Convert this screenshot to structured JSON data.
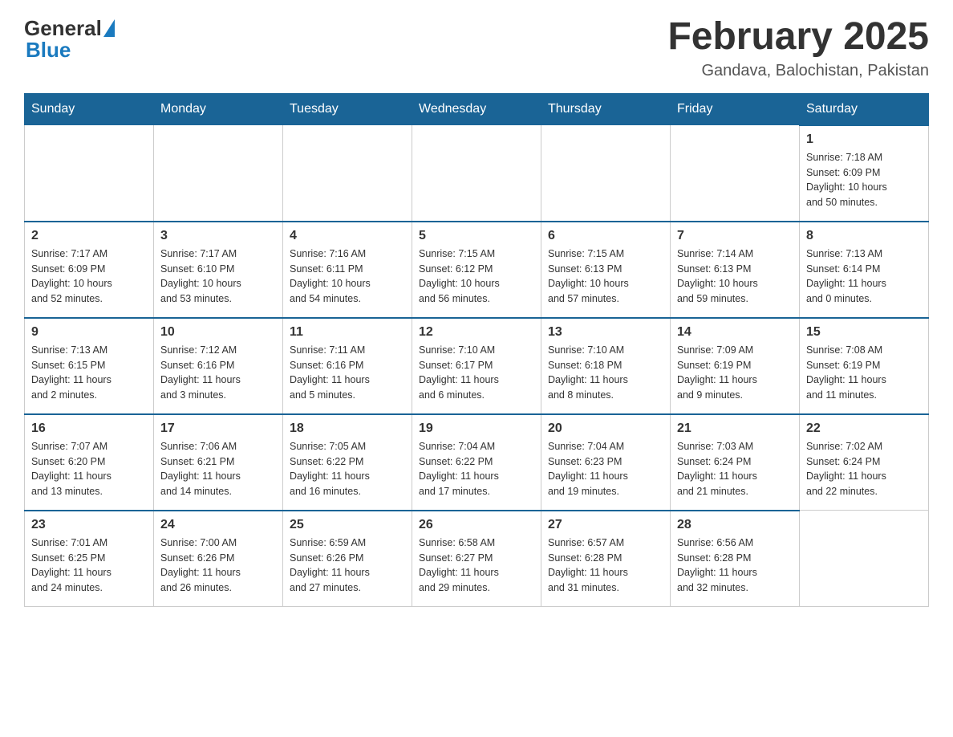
{
  "header": {
    "logo_general": "General",
    "logo_blue": "Blue",
    "title": "February 2025",
    "subtitle": "Gandava, Balochistan, Pakistan"
  },
  "days_of_week": [
    "Sunday",
    "Monday",
    "Tuesday",
    "Wednesday",
    "Thursday",
    "Friday",
    "Saturday"
  ],
  "weeks": [
    [
      {
        "day": "",
        "info": ""
      },
      {
        "day": "",
        "info": ""
      },
      {
        "day": "",
        "info": ""
      },
      {
        "day": "",
        "info": ""
      },
      {
        "day": "",
        "info": ""
      },
      {
        "day": "",
        "info": ""
      },
      {
        "day": "1",
        "info": "Sunrise: 7:18 AM\nSunset: 6:09 PM\nDaylight: 10 hours\nand 50 minutes."
      }
    ],
    [
      {
        "day": "2",
        "info": "Sunrise: 7:17 AM\nSunset: 6:09 PM\nDaylight: 10 hours\nand 52 minutes."
      },
      {
        "day": "3",
        "info": "Sunrise: 7:17 AM\nSunset: 6:10 PM\nDaylight: 10 hours\nand 53 minutes."
      },
      {
        "day": "4",
        "info": "Sunrise: 7:16 AM\nSunset: 6:11 PM\nDaylight: 10 hours\nand 54 minutes."
      },
      {
        "day": "5",
        "info": "Sunrise: 7:15 AM\nSunset: 6:12 PM\nDaylight: 10 hours\nand 56 minutes."
      },
      {
        "day": "6",
        "info": "Sunrise: 7:15 AM\nSunset: 6:13 PM\nDaylight: 10 hours\nand 57 minutes."
      },
      {
        "day": "7",
        "info": "Sunrise: 7:14 AM\nSunset: 6:13 PM\nDaylight: 10 hours\nand 59 minutes."
      },
      {
        "day": "8",
        "info": "Sunrise: 7:13 AM\nSunset: 6:14 PM\nDaylight: 11 hours\nand 0 minutes."
      }
    ],
    [
      {
        "day": "9",
        "info": "Sunrise: 7:13 AM\nSunset: 6:15 PM\nDaylight: 11 hours\nand 2 minutes."
      },
      {
        "day": "10",
        "info": "Sunrise: 7:12 AM\nSunset: 6:16 PM\nDaylight: 11 hours\nand 3 minutes."
      },
      {
        "day": "11",
        "info": "Sunrise: 7:11 AM\nSunset: 6:16 PM\nDaylight: 11 hours\nand 5 minutes."
      },
      {
        "day": "12",
        "info": "Sunrise: 7:10 AM\nSunset: 6:17 PM\nDaylight: 11 hours\nand 6 minutes."
      },
      {
        "day": "13",
        "info": "Sunrise: 7:10 AM\nSunset: 6:18 PM\nDaylight: 11 hours\nand 8 minutes."
      },
      {
        "day": "14",
        "info": "Sunrise: 7:09 AM\nSunset: 6:19 PM\nDaylight: 11 hours\nand 9 minutes."
      },
      {
        "day": "15",
        "info": "Sunrise: 7:08 AM\nSunset: 6:19 PM\nDaylight: 11 hours\nand 11 minutes."
      }
    ],
    [
      {
        "day": "16",
        "info": "Sunrise: 7:07 AM\nSunset: 6:20 PM\nDaylight: 11 hours\nand 13 minutes."
      },
      {
        "day": "17",
        "info": "Sunrise: 7:06 AM\nSunset: 6:21 PM\nDaylight: 11 hours\nand 14 minutes."
      },
      {
        "day": "18",
        "info": "Sunrise: 7:05 AM\nSunset: 6:22 PM\nDaylight: 11 hours\nand 16 minutes."
      },
      {
        "day": "19",
        "info": "Sunrise: 7:04 AM\nSunset: 6:22 PM\nDaylight: 11 hours\nand 17 minutes."
      },
      {
        "day": "20",
        "info": "Sunrise: 7:04 AM\nSunset: 6:23 PM\nDaylight: 11 hours\nand 19 minutes."
      },
      {
        "day": "21",
        "info": "Sunrise: 7:03 AM\nSunset: 6:24 PM\nDaylight: 11 hours\nand 21 minutes."
      },
      {
        "day": "22",
        "info": "Sunrise: 7:02 AM\nSunset: 6:24 PM\nDaylight: 11 hours\nand 22 minutes."
      }
    ],
    [
      {
        "day": "23",
        "info": "Sunrise: 7:01 AM\nSunset: 6:25 PM\nDaylight: 11 hours\nand 24 minutes."
      },
      {
        "day": "24",
        "info": "Sunrise: 7:00 AM\nSunset: 6:26 PM\nDaylight: 11 hours\nand 26 minutes."
      },
      {
        "day": "25",
        "info": "Sunrise: 6:59 AM\nSunset: 6:26 PM\nDaylight: 11 hours\nand 27 minutes."
      },
      {
        "day": "26",
        "info": "Sunrise: 6:58 AM\nSunset: 6:27 PM\nDaylight: 11 hours\nand 29 minutes."
      },
      {
        "day": "27",
        "info": "Sunrise: 6:57 AM\nSunset: 6:28 PM\nDaylight: 11 hours\nand 31 minutes."
      },
      {
        "day": "28",
        "info": "Sunrise: 6:56 AM\nSunset: 6:28 PM\nDaylight: 11 hours\nand 32 minutes."
      },
      {
        "day": "",
        "info": ""
      }
    ]
  ]
}
